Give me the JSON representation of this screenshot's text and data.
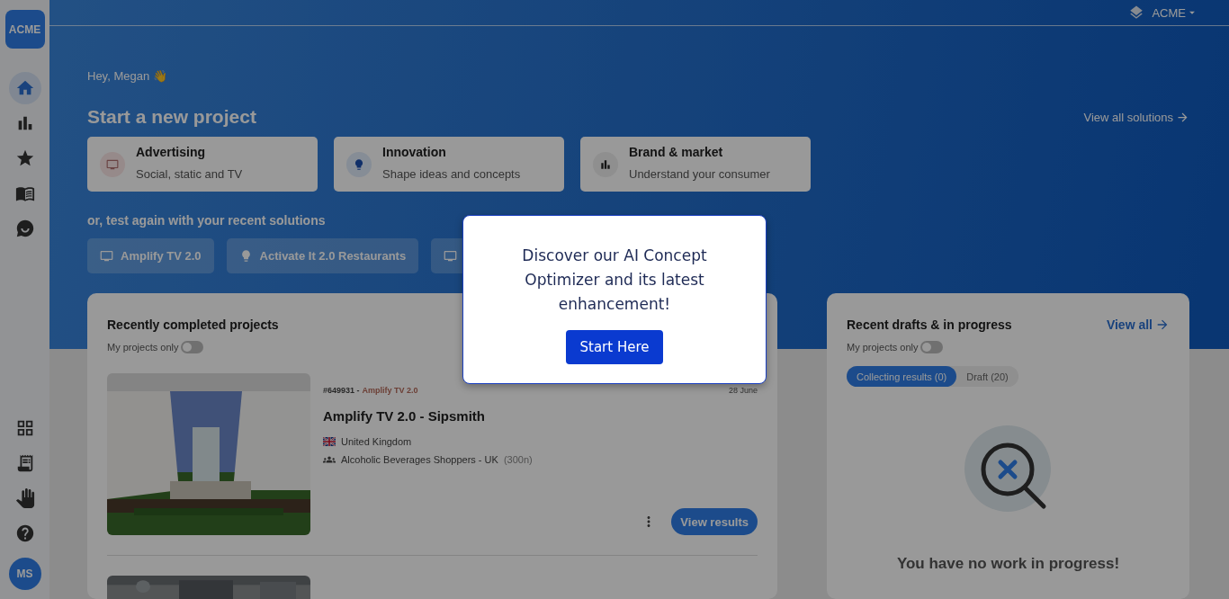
{
  "sidebar": {
    "logo": "ACME",
    "nav": [
      {
        "kind": "home",
        "selected": true
      },
      {
        "kind": "chart",
        "selected": false
      },
      {
        "kind": "star",
        "selected": false
      },
      {
        "kind": "book",
        "selected": false
      },
      {
        "kind": "sparkle-chat",
        "selected": false
      }
    ],
    "bottom": [
      {
        "kind": "grid"
      },
      {
        "kind": "receipt"
      },
      {
        "kind": "hand"
      },
      {
        "kind": "help"
      }
    ],
    "avatar": "MS"
  },
  "topbar": {
    "workspace": "ACME"
  },
  "greeting": "Hey, Megan 👋",
  "start": {
    "title": "Start a new project",
    "view_all": "View all solutions",
    "cards": [
      {
        "kind": "tv",
        "title": "Advertising",
        "subtitle": "Social, static and TV"
      },
      {
        "kind": "bulb",
        "title": "Innovation",
        "subtitle": "Shape ideas and concepts"
      },
      {
        "kind": "chart",
        "title": "Brand & market",
        "subtitle": "Understand your consumer"
      }
    ]
  },
  "recent": {
    "label": "or, test again with your recent solutions",
    "chips": [
      {
        "kind": "tv",
        "label": "Amplify TV 2.0"
      },
      {
        "kind": "bulb",
        "label": "Activate It 2.0 Restaurants"
      },
      {
        "kind": "tv"
      }
    ]
  },
  "completed": {
    "title": "Recently completed projects",
    "toggle": {
      "label": "My projects only",
      "on": false
    },
    "projects": [
      {
        "id": "#649931 -",
        "solution": "Amplify TV 2.0",
        "date": "28 June",
        "name": "Amplify TV 2.0 - Sipsmith",
        "country": "United Kingdom",
        "audience": "Alcoholic Beverages Shoppers - UK",
        "sample": "(300n)",
        "button": "View results"
      }
    ]
  },
  "drafts": {
    "title": "Recent drafts & in progress",
    "view_all": "View all",
    "toggle": {
      "label": "My projects only",
      "on": false
    },
    "tabs": [
      {
        "label": "Collecting results (0)",
        "selected": true
      },
      {
        "label": "Draft (20)",
        "selected": false
      }
    ],
    "empty": "You have no work in progress!"
  },
  "modal": {
    "text": "Discover our AI Concept Optimizer and its latest enhancement!",
    "button": "Start Here"
  }
}
